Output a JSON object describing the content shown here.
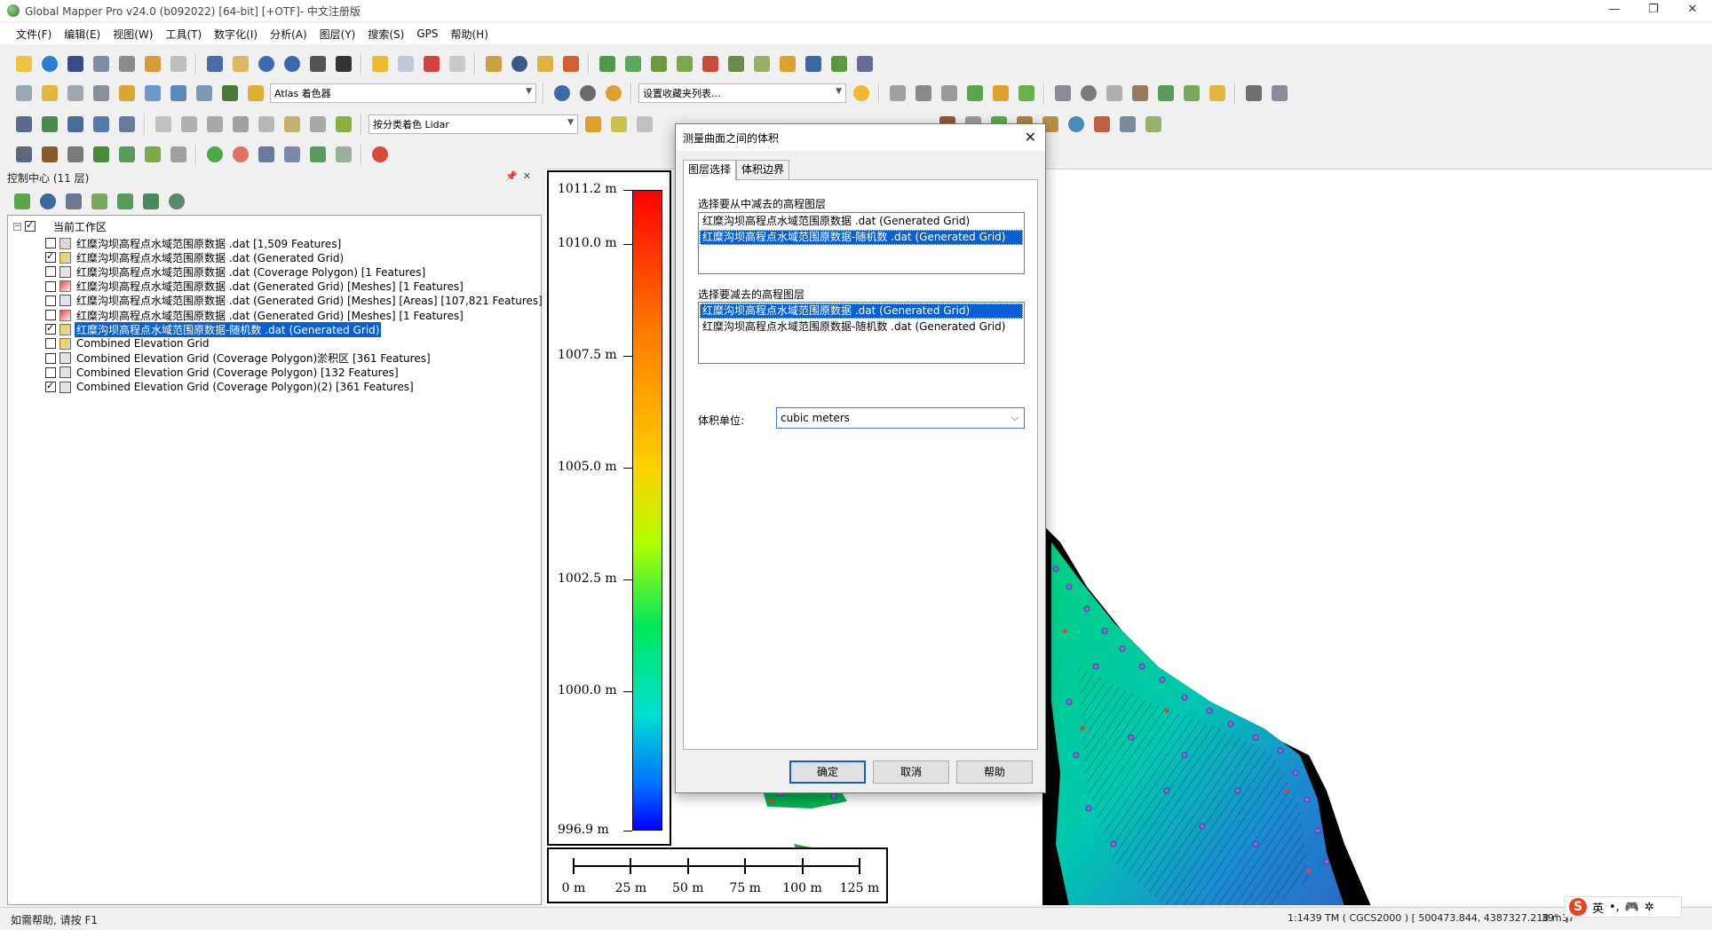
{
  "window": {
    "title": "Global Mapper Pro v24.0 (b092022) [64-bit] [+OTF]- 中文注册版",
    "minimize": "—",
    "maximize": "❐",
    "close": "✕"
  },
  "menu": [
    "文件(F)",
    "编辑(E)",
    "视图(W)",
    "工具(T)",
    "数字化(I)",
    "分析(A)",
    "图层(Y)",
    "搜索(S)",
    "GPS",
    "帮助(H)"
  ],
  "toolbars": {
    "shader_combo": "Atlas 着色器",
    "favorites_combo": "设置收藏夹列表...",
    "lidar_combo": "按分类着色 Lidar"
  },
  "control_center": {
    "title": "控制中心 (11 层)",
    "pin": "📌",
    "close": "✕",
    "root_label": "当前工作区",
    "layers": [
      {
        "label": "红糜沟坝高程点水域范围原数据 .dat [1,509 Features]",
        "checked": false,
        "icon": "point-layer",
        "selected": false
      },
      {
        "label": "红糜沟坝高程点水域范围原数据 .dat (Generated Grid)",
        "checked": true,
        "icon": "grid-layer",
        "selected": false
      },
      {
        "label": "红糜沟坝高程点水域范围原数据 .dat (Coverage Polygon) [1 Features]",
        "checked": false,
        "icon": "polygon-layer",
        "selected": false
      },
      {
        "label": "红糜沟坝高程点水域范围原数据 .dat (Generated Grid) [Meshes] [1 Features]",
        "checked": false,
        "icon": "mesh-layer",
        "selected": false
      },
      {
        "label": "红糜沟坝高程点水域范围原数据 .dat (Generated Grid) [Meshes] [Areas] [107,821 Features]",
        "checked": false,
        "icon": "polygon-layer",
        "selected": false
      },
      {
        "label": "红糜沟坝高程点水域范围原数据 .dat (Generated Grid) [Meshes] [1 Features]",
        "checked": false,
        "icon": "mesh-layer",
        "selected": false
      },
      {
        "label": "红糜沟坝高程点水域范围原数据-随机数 .dat (Generated Grid)",
        "checked": true,
        "icon": "grid-layer",
        "selected": true
      },
      {
        "label": "Combined Elevation Grid",
        "checked": false,
        "icon": "grid-layer",
        "selected": false
      },
      {
        "label": "Combined Elevation Grid (Coverage Polygon)淤积区 [361 Features]",
        "checked": false,
        "icon": "polygon-layer",
        "selected": false
      },
      {
        "label": "Combined Elevation Grid (Coverage Polygon) [132 Features]",
        "checked": false,
        "icon": "polygon-layer",
        "selected": false
      },
      {
        "label": "Combined Elevation Grid (Coverage Polygon)(2) [361 Features]",
        "checked": true,
        "icon": "polygon-layer",
        "selected": false
      }
    ]
  },
  "legend": {
    "labels": [
      {
        "text": "1011.2 m",
        "value": 1011.2
      },
      {
        "text": "1010.0 m",
        "value": 1010.0
      },
      {
        "text": "1007.5 m",
        "value": 1007.5
      },
      {
        "text": "1005.0 m",
        "value": 1005.0
      },
      {
        "text": "1002.5 m",
        "value": 1002.5
      },
      {
        "text": "1000.0 m",
        "value": 1000.0
      },
      {
        "text": "996.9 m",
        "value": 996.9
      }
    ],
    "min": 996.9,
    "max": 1011.2
  },
  "scalebar": {
    "labels": [
      "0 m",
      "25 m",
      "50 m",
      "75 m",
      "100 m",
      "125 m"
    ]
  },
  "dialog": {
    "title": "测量曲面之间的体积",
    "close": "✕",
    "tabs": [
      "图层选择",
      "体积边界"
    ],
    "from_label": "选择要从中减去的高程图层",
    "from_items": [
      {
        "text": "红糜沟坝高程点水域范围原数据 .dat (Generated Grid)",
        "selected": false
      },
      {
        "text": "红糜沟坝高程点水域范围原数据-随机数 .dat (Generated Grid)",
        "selected": true
      }
    ],
    "subtract_label": "选择要减去的高程图层",
    "subtract_items": [
      {
        "text": "红糜沟坝高程点水域范围原数据 .dat (Generated Grid)",
        "selected": true
      },
      {
        "text": "红糜沟坝高程点水域范围原数据-随机数 .dat (Generated Grid)",
        "selected": false
      }
    ],
    "unit_label": "体积单位:",
    "unit_value": "cubic meters",
    "ok": "确定",
    "cancel": "取消",
    "help": "帮助"
  },
  "status": {
    "help_text": "如需帮助, 请按 F1",
    "scale": "1:1439",
    "coords": "TM ( CGCS2000 ) [ 500473.844, 4387327.218 m ]",
    "lat": "39° 37",
    "ime": "英"
  }
}
